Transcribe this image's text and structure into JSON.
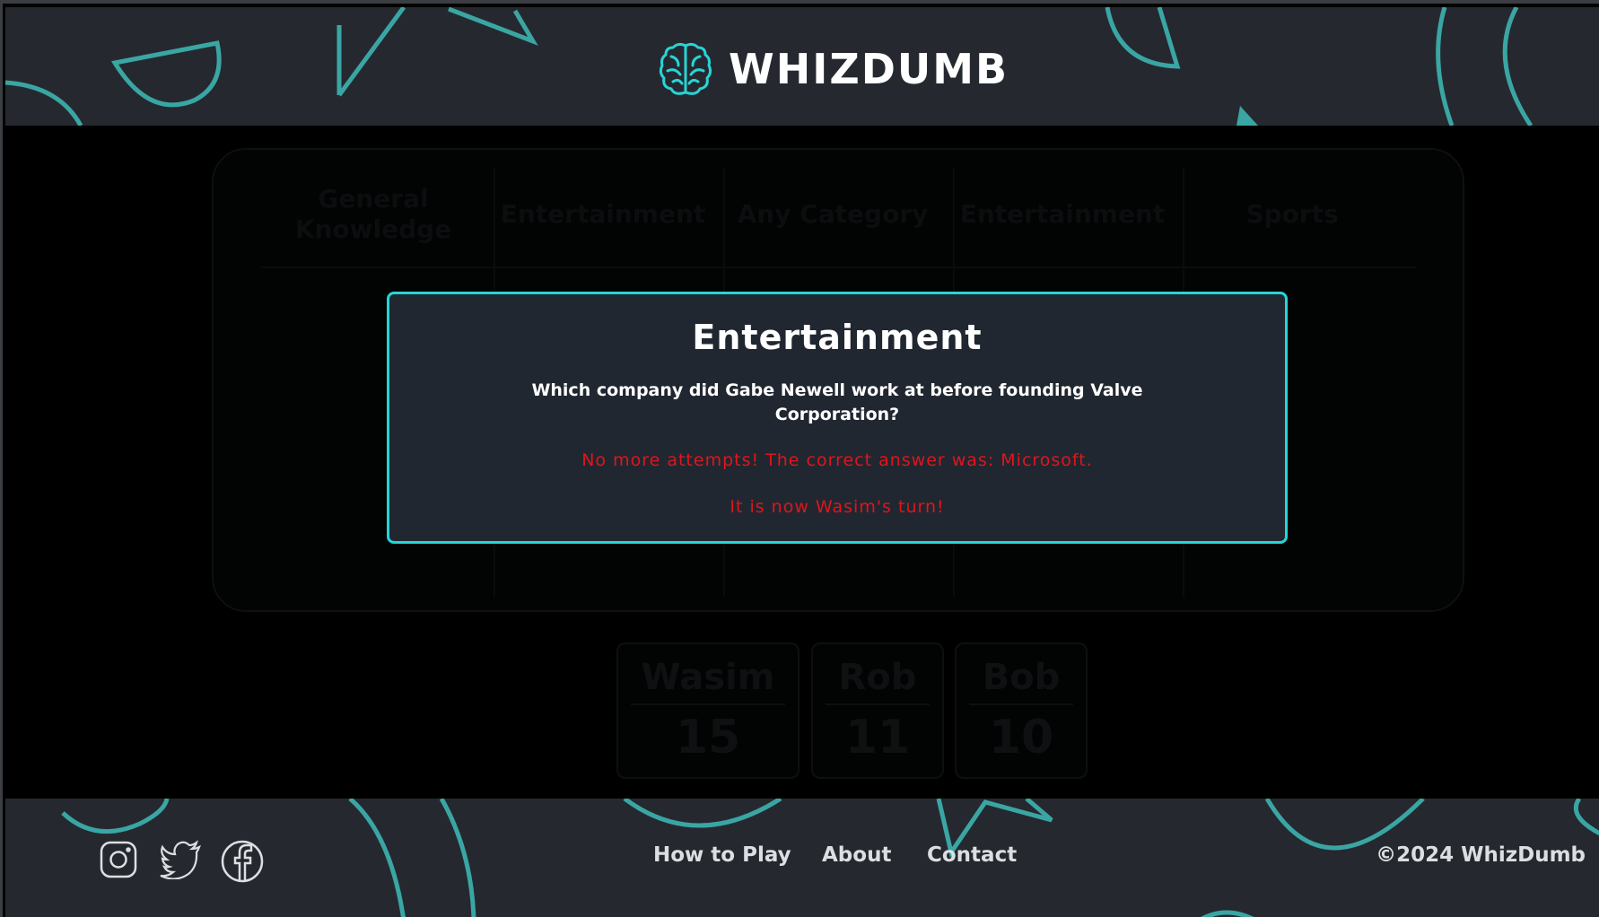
{
  "header": {
    "title": "WHIZDUMB",
    "logo_icon": "brain-icon"
  },
  "board": {
    "categories": [
      "General Knowledge",
      "Entertainment",
      "Any Category",
      "Entertainment",
      "Sports"
    ]
  },
  "scores": [
    {
      "name": "Wasim",
      "score": "15"
    },
    {
      "name": "Rob",
      "score": "11"
    },
    {
      "name": "Bob",
      "score": "10"
    }
  ],
  "modal": {
    "title": "Entertainment",
    "question": "Which company did Gabe Newell work at before founding Valve Corporation?",
    "result": "No more attempts! The correct answer was: Microsoft.",
    "turn": "It is now Wasim's turn!"
  },
  "footer": {
    "social_icons": [
      "instagram-icon",
      "twitter-icon",
      "facebook-icon"
    ],
    "links": [
      "How to Play",
      "About",
      "Contact"
    ],
    "copyright": "©2024 WhizDumb"
  },
  "colors": {
    "accent": "#27d4d6",
    "panel": "#25292f",
    "modal_bg": "#212730",
    "error": "#e0151c",
    "deco": "#3aa6a4"
  }
}
